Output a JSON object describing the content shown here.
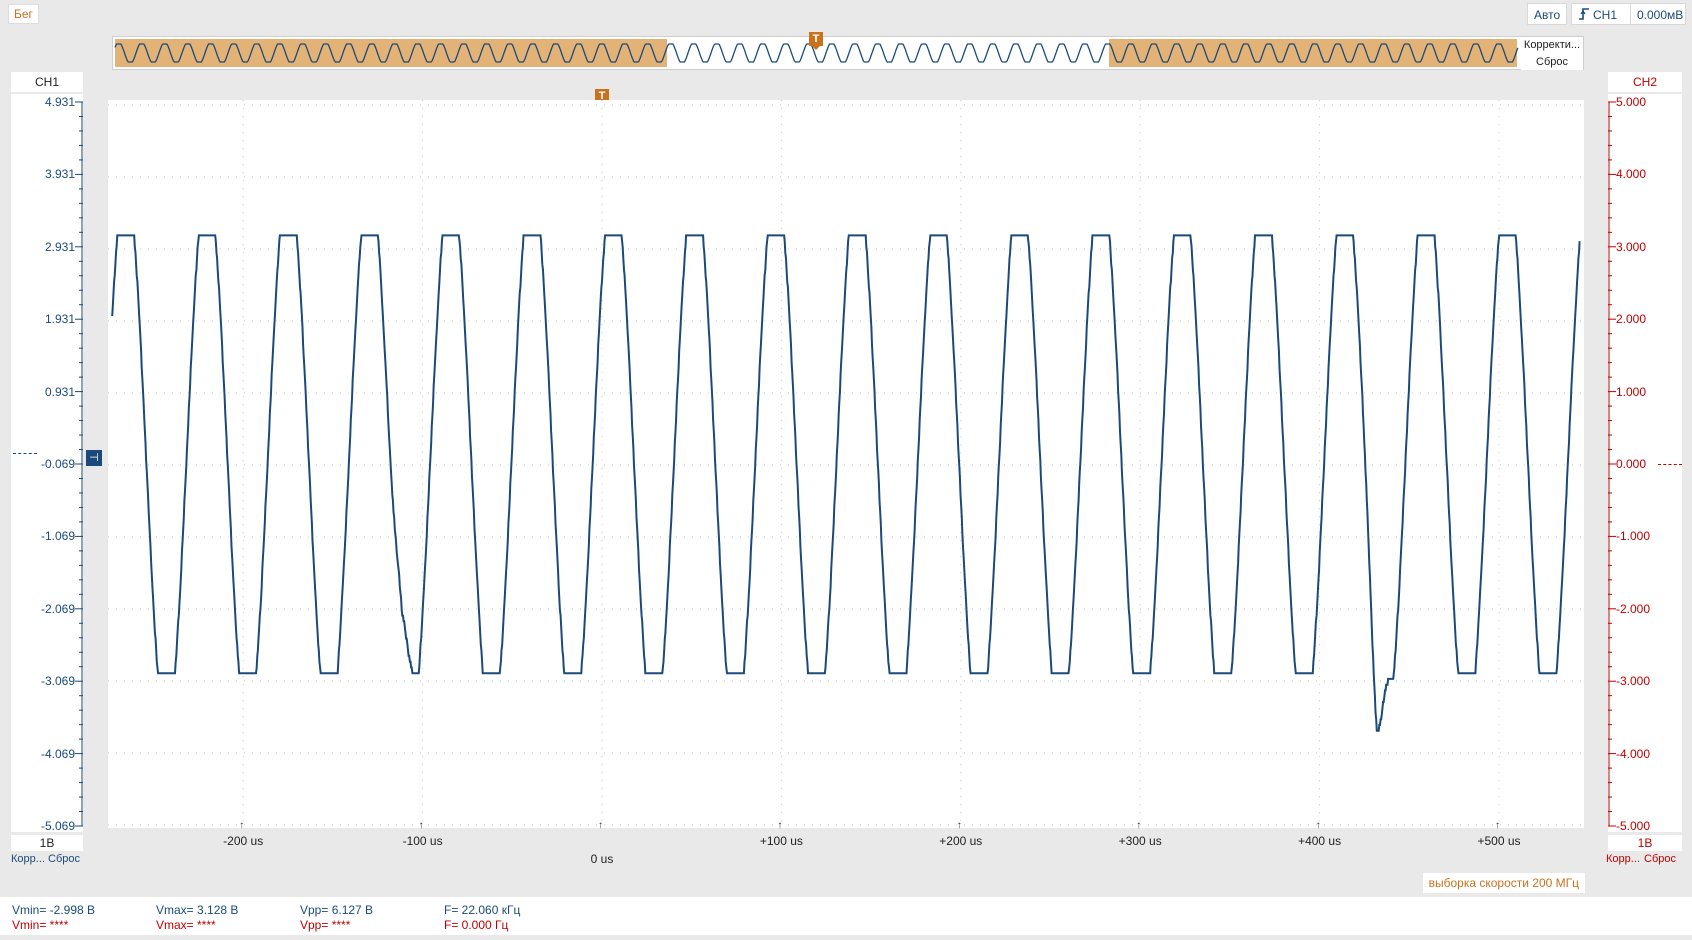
{
  "status": "Бег",
  "toolbar": {
    "trigger_mode": "Авто",
    "trigger_source": "CH1",
    "trigger_level": "0.000мВ"
  },
  "overview": {
    "correction_label": "Корректи...",
    "reset_label": "Сброс",
    "trigger_marker": "T"
  },
  "trigger_marker": "T",
  "ch1": {
    "title": "CH1",
    "scale": "1В",
    "correction": "Корр...",
    "reset": "Сброс",
    "ticks": [
      "4.931",
      "3.931",
      "2.931",
      "1.931",
      "0.931",
      "-0.069",
      "-1.069",
      "-2.069",
      "-3.069",
      "-4.069",
      "-5.069"
    ]
  },
  "ch2": {
    "title": "CH2",
    "scale": "1В",
    "correction": "Корр...",
    "reset": "Сброс",
    "ticks": [
      "5.000",
      "4.000",
      "3.000",
      "2.000",
      "1.000",
      "0.000",
      "-1.000",
      "-2.000",
      "-3.000",
      "-4.000",
      "-5.000"
    ]
  },
  "time_axis": {
    "ticks": [
      "-200 us",
      "-100 us",
      "0 us",
      "+100 us",
      "+200 us",
      "+300 us",
      "+400 us",
      "+500 us"
    ]
  },
  "sample_rate": "выборка скорости 200 МГц",
  "measurements": {
    "ch1": {
      "vmin": "Vmin= -2.998 В",
      "vmax": "Vmax= 3.128 В",
      "vpp": "Vpp= 6.127 В",
      "freq": "F= 22.060 кГц"
    },
    "ch2": {
      "vmin": "Vmin= ****",
      "vmax": "Vmax= ****",
      "vpp": "Vpp= ****",
      "freq": "F= 0.000 Гц"
    }
  },
  "colors": {
    "ch1": "#1b4a7a",
    "ch2": "#c00000",
    "accent": "#c8721e",
    "overview_highlight": "#e2b276"
  },
  "chart_data": {
    "type": "line",
    "series": [
      {
        "name": "CH1",
        "period_us": 45.3,
        "vmin": -2.998,
        "vmax": 3.128
      }
    ],
    "xlim_us": [
      -275,
      545
    ],
    "ylim_v": [
      -5.069,
      4.931
    ],
    "grid": true
  }
}
